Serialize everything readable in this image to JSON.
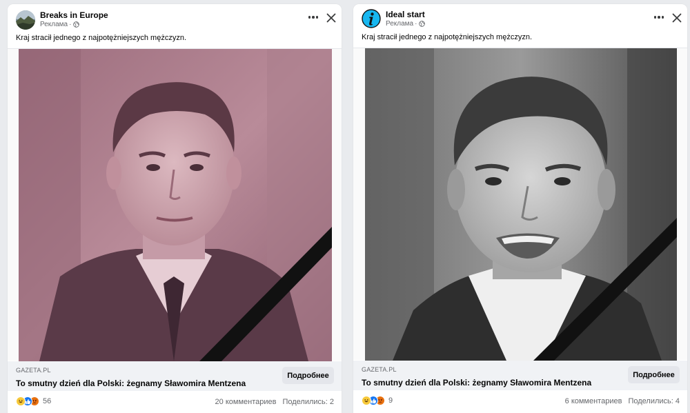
{
  "colors": {
    "accent": "#1877f2",
    "text": "#050505",
    "muted": "#65676b",
    "ribbon": "#111111"
  },
  "posts": [
    {
      "author": "Breaks in Europe",
      "avatar_icon": "landscape-avatar-icon",
      "sponsored": "Реклама",
      "separator": "·",
      "text": "Kraj stracił jednego z najpotężniejszych mężczyzn.",
      "image_tint": "pink-mauve",
      "domain": "GAZETA.PL",
      "headline": "To smutny dzień dla Polski: żegnamy Sławomira Mentzena",
      "cta": "Подробнее",
      "reactions": [
        "haha-icon",
        "like-icon",
        "angry-icon"
      ],
      "reaction_count": "56",
      "comments": "20 комментариев",
      "shares": "Поделились: 2"
    },
    {
      "author": "Ideal start",
      "avatar_icon": "info-avatar-icon",
      "sponsored": "Реклама",
      "separator": "·",
      "text": "Kraj stracił jednego z najpotężniejszych mężczyzn.",
      "image_tint": "grayscale",
      "domain": "GAZETA.PL",
      "headline": "To smutny dzień dla Polski: żegnamy Sławomira Mentzena",
      "cta": "Подробнее",
      "reactions": [
        "haha-icon",
        "like-icon",
        "angry-icon"
      ],
      "reaction_count": "9",
      "comments": "6 комментариев",
      "shares": "Поделились: 4"
    }
  ]
}
